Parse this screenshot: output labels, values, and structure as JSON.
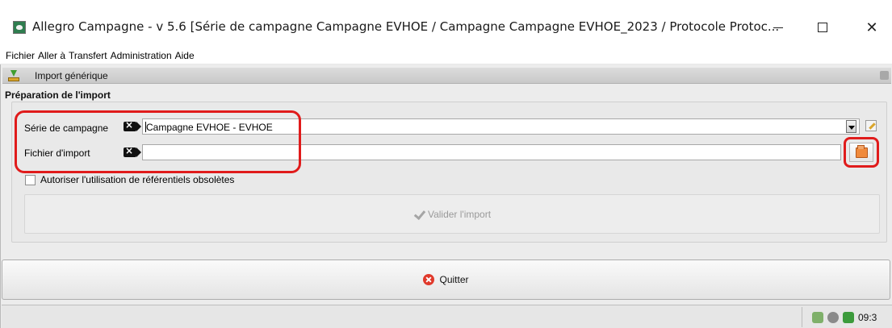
{
  "window": {
    "title": "Allegro Campagne - v 5.6 [Série de campagne Campagne EVHOE / Campagne Campagne EVHOE_2023 / Protocole Protoc...",
    "minimize_label": "—",
    "maximize_label": "",
    "close_label": "✕"
  },
  "menu": {
    "items": [
      "Fichier",
      "Aller à",
      "Transfert",
      "Administration",
      "Aide"
    ]
  },
  "panel": {
    "title": "Import générique",
    "section_title": "Préparation de l'import"
  },
  "form": {
    "campaign_series_label": "Série de campagne",
    "campaign_series_value": "Campagne EVHOE - EVHOE",
    "import_file_label": "Fichier d'import",
    "import_file_value": "",
    "obsolete_checkbox_label": "Autoriser l'utilisation de référentiels obsolètes",
    "obsolete_checked": false,
    "validate_button": "Valider l'import",
    "validate_enabled": false
  },
  "footer": {
    "quit_button": "Quitter",
    "clock": "09:3"
  },
  "colors": {
    "annotation": "#e01b1b",
    "panel_bg": "#ececec",
    "header_bg": "#d4d4d4"
  },
  "icons": [
    "app-icon",
    "download-icon",
    "help-icon",
    "tag-icon",
    "dropdown-arrow-icon",
    "edit-icon",
    "folder-icon",
    "check-icon",
    "quit-icon",
    "network-icon",
    "globe-icon",
    "flag-icon"
  ]
}
